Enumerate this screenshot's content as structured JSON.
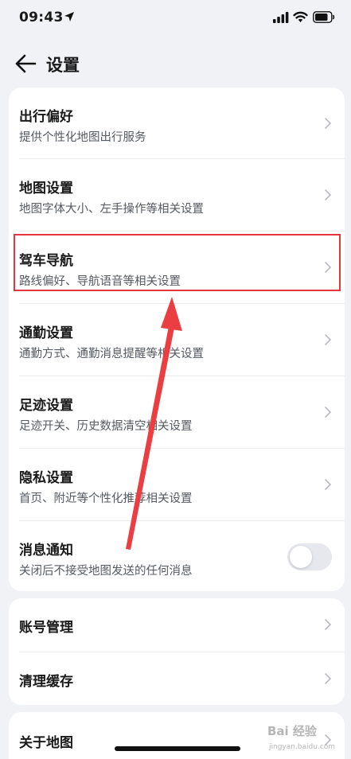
{
  "status_bar": {
    "time": "09:43",
    "icons": [
      "location-arrow-icon",
      "cellular-signal-icon",
      "wifi-icon",
      "battery-icon"
    ]
  },
  "nav": {
    "back_icon": "arrow-left-icon",
    "title": "设置"
  },
  "settings_main": [
    {
      "title": "出行偏好",
      "subtitle": "提供个性化地图出行服务"
    },
    {
      "title": "地图设置",
      "subtitle": "地图字体大小、左手操作等相关设置"
    },
    {
      "title": "驾车导航",
      "subtitle": "路线偏好、导航语音等相关设置"
    },
    {
      "title": "通勤设置",
      "subtitle": "通勤方式、通勤消息提醒等相关设置"
    },
    {
      "title": "足迹设置",
      "subtitle": "足迹开关、历史数据清空相关设置"
    },
    {
      "title": "隐私设置",
      "subtitle": "首页、附近等个性化推荐相关设置"
    },
    {
      "title": "消息通知",
      "subtitle": "关闭后不接受地图发送的任何消息",
      "toggle_on": false
    }
  ],
  "settings_account": [
    {
      "title": "账号管理"
    },
    {
      "title": "清理缓存"
    }
  ],
  "settings_about": [
    {
      "title": "关于地图"
    }
  ],
  "annotation": {
    "highlight_color": "#e8343c",
    "highlighted_item": "驾车导航"
  },
  "watermark": {
    "brand": "Bai 经验",
    "url": "jingyan.baidu.com"
  },
  "colors": {
    "background": "#f1f2f5",
    "card": "#ffffff",
    "title_text": "#1a1a1a",
    "subtitle_text": "#555a62",
    "chevron": "#b8bbc2",
    "toggle_off": "#e6e8ed"
  }
}
